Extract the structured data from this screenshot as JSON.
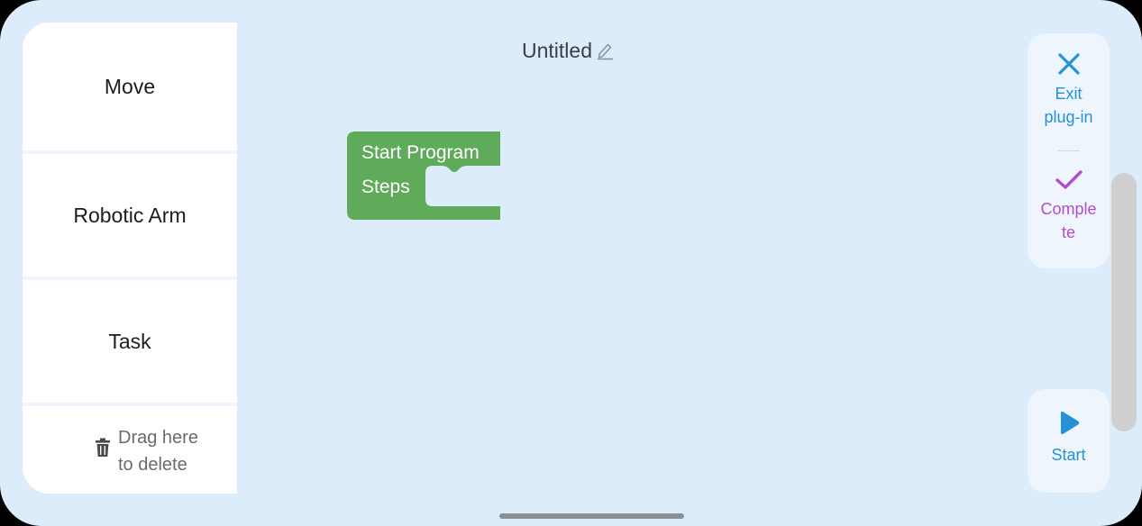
{
  "header": {
    "title": "Untitled"
  },
  "palette": {
    "categories": [
      {
        "label": "Move"
      },
      {
        "label": "Robotic Arm"
      },
      {
        "label": "Task"
      }
    ],
    "trash_label_line1": "Drag here",
    "trash_label_line2": "to delete"
  },
  "workspace": {
    "block": {
      "line1": "Start Program",
      "line2": "Steps",
      "color": "#5fab5a"
    }
  },
  "actions": {
    "exit_line1": "Exit",
    "exit_line2": "plug-in",
    "complete_line1": "Comple",
    "complete_line2": "te",
    "start_label": "Start"
  },
  "colors": {
    "background": "#dcecfb",
    "accent_blue": "#2591d6",
    "accent_purple": "#b04fc7",
    "block_green": "#5fab5a"
  },
  "icons": {
    "edit": "pencil-icon",
    "trash": "trash-icon",
    "exit": "close-icon",
    "complete": "check-icon",
    "start": "play-icon"
  }
}
